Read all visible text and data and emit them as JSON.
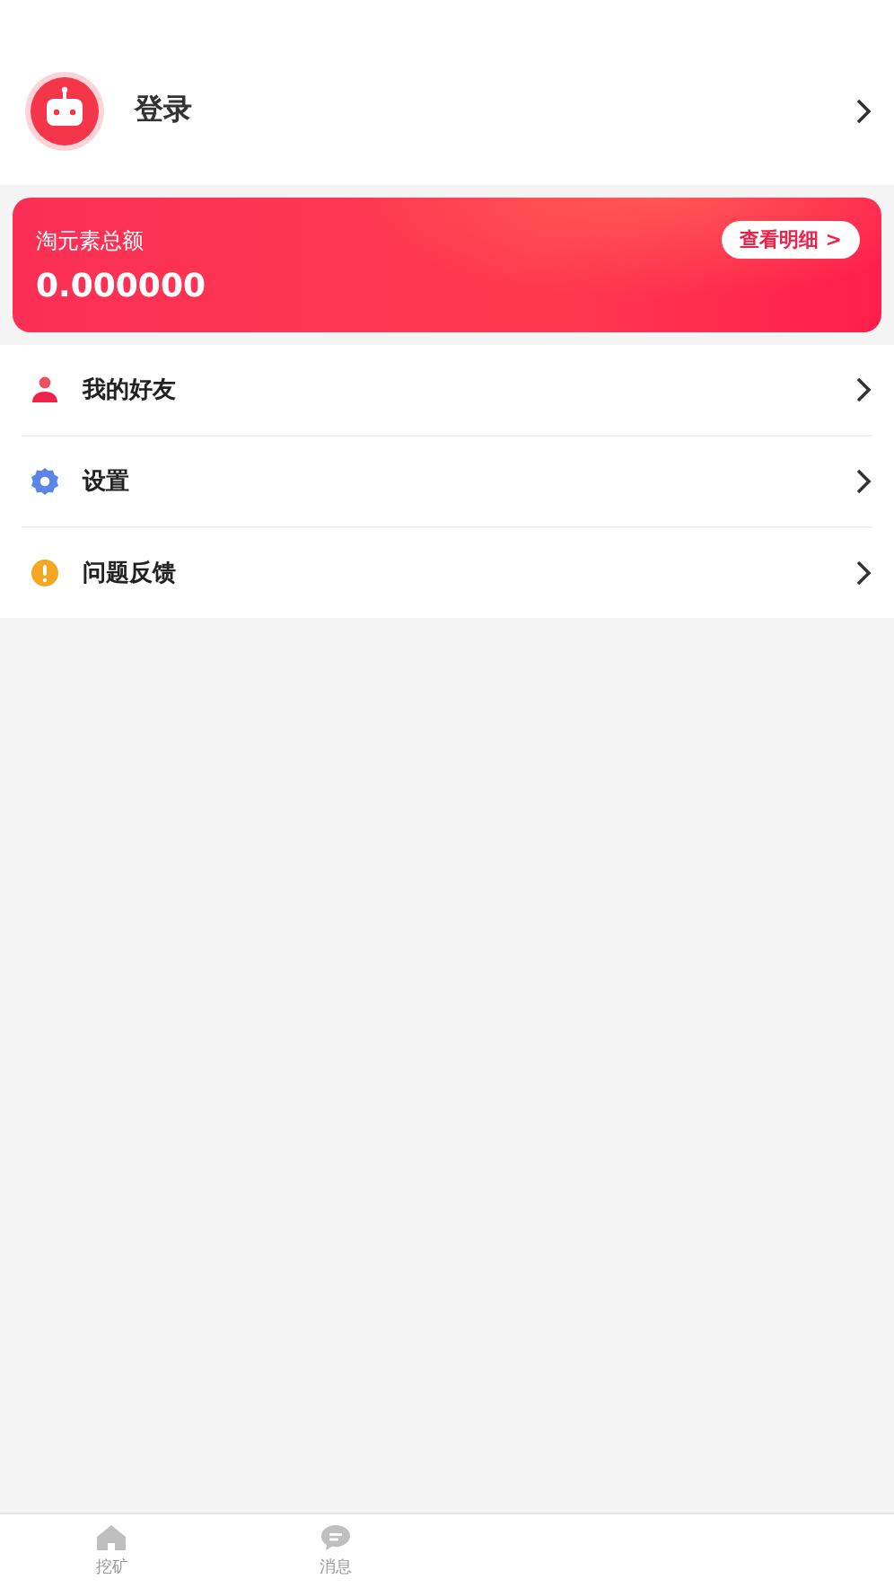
{
  "profile": {
    "label": "登录"
  },
  "balance_card": {
    "title": "淘元素总额",
    "amount": "0.000000",
    "details_button": "查看明细 >"
  },
  "menu": [
    {
      "kind": "friends",
      "label": "我的好友"
    },
    {
      "kind": "settings",
      "label": "设置"
    },
    {
      "kind": "feedback",
      "label": "问题反馈"
    }
  ],
  "tab_bar": [
    {
      "kind": "home",
      "label": "挖矿",
      "selected": false
    },
    {
      "kind": "chat",
      "label": "消息",
      "selected": false
    }
  ]
}
